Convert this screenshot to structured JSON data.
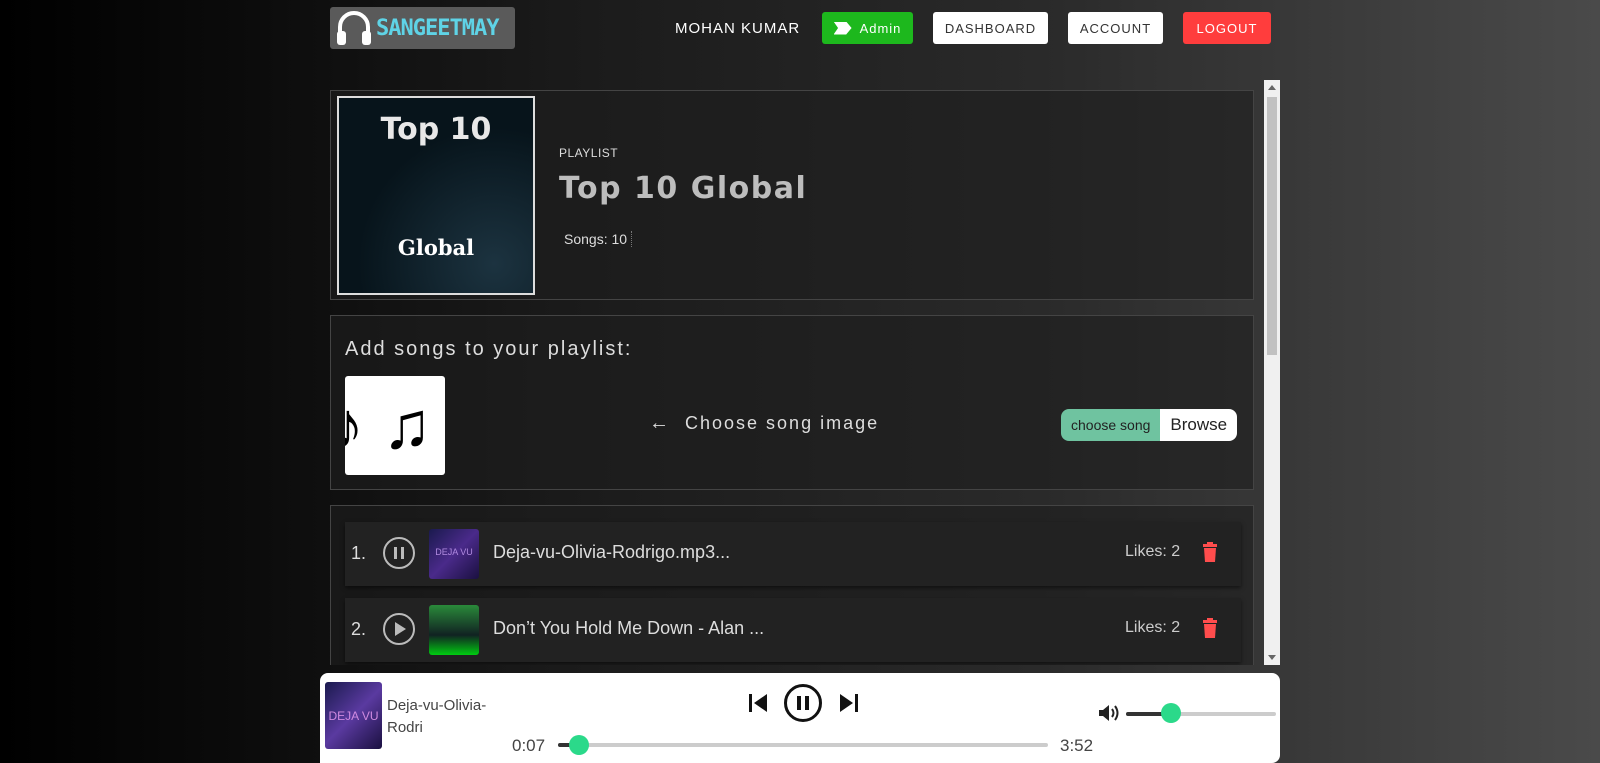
{
  "nav": {
    "logo_text": "SANGEETMAY",
    "user_name": "MOHAN KUMAR",
    "admin_label": "Admin",
    "dashboard_label": "DASHBOARD",
    "account_label": "ACCOUNT",
    "logout_label": "LOGOUT"
  },
  "playlist": {
    "cover_top": "Top 10",
    "cover_bottom": "Global",
    "type_label": "PLAYLIST",
    "title": "Top 10 Global",
    "songs_count": "Songs: 10"
  },
  "add_songs": {
    "title": "Add songs to your playlist:",
    "choose_image": "Choose song image",
    "choose_song": "choose song",
    "browse": "Browse",
    "placeholder_icon": "music-notes-icon"
  },
  "songs": [
    {
      "index": "1.",
      "name": "Deja-vu-Olivia-Rodrigo.mp3...",
      "likes": "Likes: 2",
      "thumb_text": "DEJA VU",
      "state": "playing"
    },
    {
      "index": "2.",
      "name": "Don’t You Hold Me Down - Alan ...",
      "likes": "Likes: 2",
      "thumb_text": "",
      "state": "paused"
    }
  ],
  "player": {
    "thumb_text": "DEJA VU",
    "track_name": "Deja-vu-Olivia-Rodri",
    "current_time": "0:07",
    "total_time": "3:52",
    "progress": 0.03,
    "volume": 0.3
  },
  "colors": {
    "accent": "#2bd98a",
    "admin": "#1db81d",
    "logout": "#ff3d3d",
    "logo_text": "#5fd3e6"
  }
}
